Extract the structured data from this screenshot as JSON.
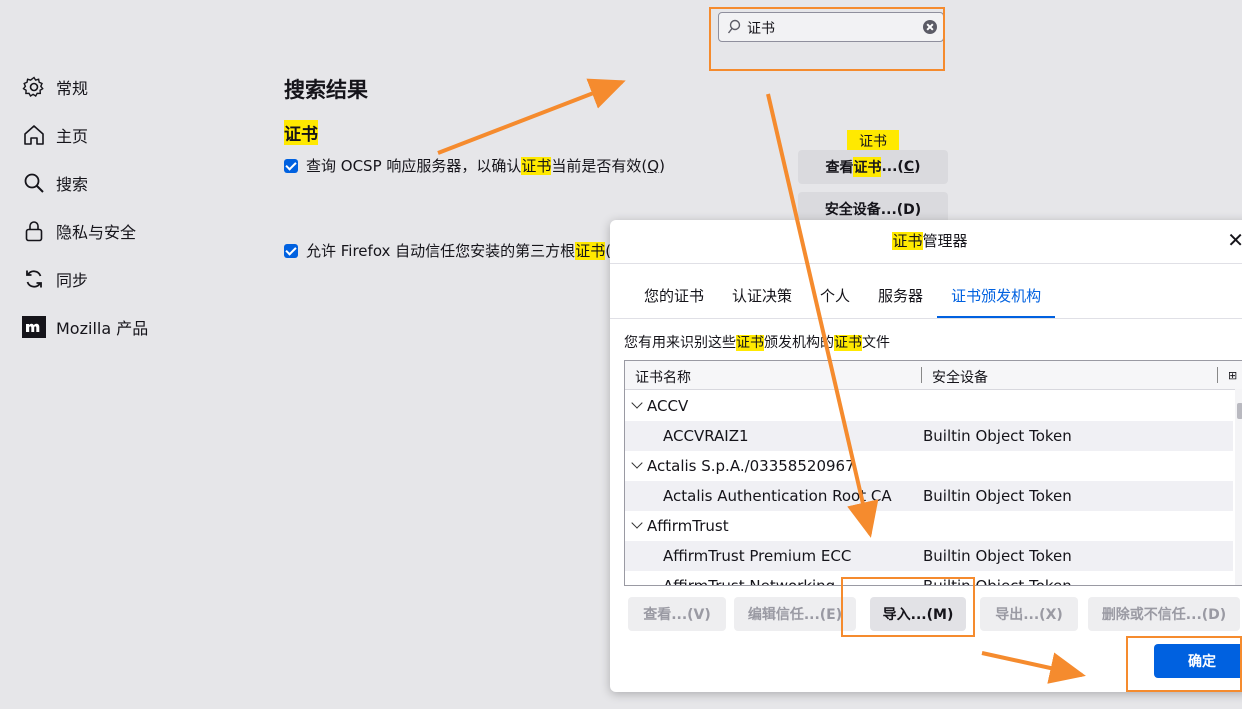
{
  "search": {
    "query": "证书"
  },
  "sidebar": {
    "items": [
      {
        "label": "常规",
        "icon": "gear-icon"
      },
      {
        "label": "主页",
        "icon": "home-icon"
      },
      {
        "label": "搜索",
        "icon": "search-icon"
      },
      {
        "label": "隐私与安全",
        "icon": "lock-icon"
      },
      {
        "label": "同步",
        "icon": "sync-icon"
      },
      {
        "label": "Mozilla 产品",
        "icon": "mozilla-logo-icon"
      }
    ]
  },
  "main": {
    "title": "搜索结果",
    "section": "证书",
    "tip_chip": "证书",
    "ocsp": {
      "pre": "查询 OCSP 响应服务器，以确认",
      "hl": "证书",
      "post": "当前是否有效(",
      "key": "Q",
      "end": ")"
    },
    "trust_third_party": {
      "pre": "允许 Firefox 自动信任您安装的第三方根",
      "hl": "证书",
      "post": "("
    },
    "view_certs": {
      "pre": "查看",
      "hl": "证书",
      "post": "...(",
      "key": "C",
      "end": ")"
    },
    "security_devices": "安全设备...(D)"
  },
  "dialog": {
    "title_hl": "证书",
    "title_rest": "管理器",
    "tabs": [
      "您的证书",
      "认证决策",
      "个人",
      "服务器",
      "证书颁发机构"
    ],
    "active_tab": 4,
    "desc": {
      "a": "您有用来识别这些",
      "b": "证书",
      "c": "颁发机构的",
      "d": "证书",
      "e": "文件"
    },
    "columns": [
      "证书名称",
      "安全设备"
    ],
    "rows": [
      {
        "group": "ACCV"
      },
      {
        "name": "ACCVRAIZ1",
        "device": "Builtin Object Token"
      },
      {
        "group": "Actalis S.p.A./03358520967"
      },
      {
        "name": "Actalis Authentication Root CA",
        "device": "Builtin Object Token"
      },
      {
        "group": "AffirmTrust"
      },
      {
        "name": "AffirmTrust Premium ECC",
        "device": "Builtin Object Token"
      },
      {
        "name": "AffirmTrust Networking",
        "device": "Builtin Object Token"
      }
    ],
    "buttons": {
      "view": "查看...(V)",
      "edit_trust": "编辑信任...(E)",
      "import": "导入...(M)",
      "export": "导出...(X)",
      "delete_distrust": "删除或不信任...(D)",
      "ok": "确定"
    }
  },
  "colors": {
    "accent": "#0061e0",
    "highlight": "#ffe900",
    "annotation": "#f58b2e"
  }
}
